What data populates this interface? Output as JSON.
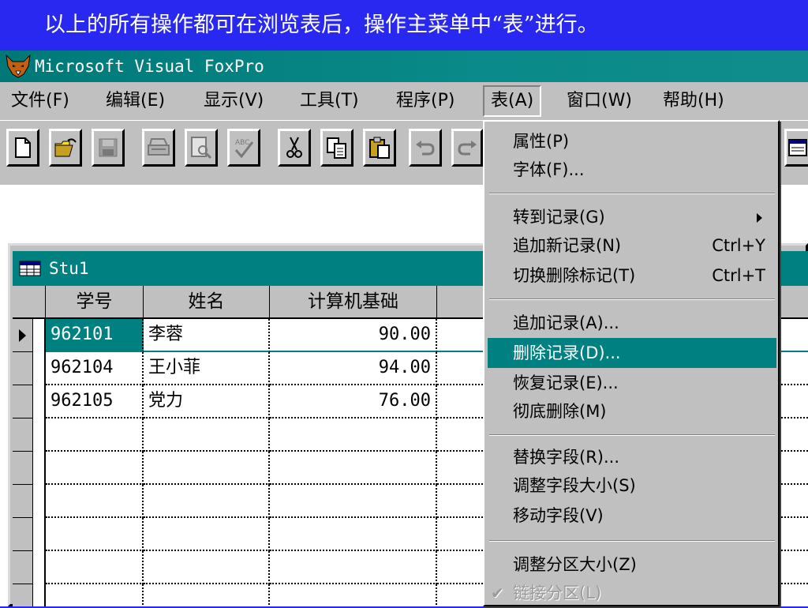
{
  "caption": "以上的所有操作都可在浏览表后，操作主菜单中“表”进行。",
  "window": {
    "title": "Microsoft Visual FoxPro"
  },
  "menubar": [
    {
      "label": "文件(F)"
    },
    {
      "label": "编辑(E)"
    },
    {
      "label": "显示(V)"
    },
    {
      "label": "工具(T)"
    },
    {
      "label": "程序(P)"
    },
    {
      "label": "表(A)",
      "active": true
    },
    {
      "label": "窗口(W)"
    },
    {
      "label": "帮助(H)"
    }
  ],
  "toolbar": {
    "buttons": [
      "new-icon",
      "open-icon",
      "save-icon",
      "print-icon",
      "print-preview-icon",
      "spell-check-icon",
      "cut-icon",
      "copy-icon",
      "paste-icon",
      "undo-icon",
      "redo-icon"
    ]
  },
  "browse": {
    "title": "Stu1",
    "columns": [
      "学号",
      "姓名",
      "计算机基础"
    ],
    "rows": [
      {
        "id": "962101",
        "name": "李蓉",
        "score": "90.00",
        "current": true
      },
      {
        "id": "962104",
        "name": "王小菲",
        "score": "94.00"
      },
      {
        "id": "962105",
        "name": "党力",
        "score": "76.00"
      }
    ]
  },
  "table_menu": {
    "groups": [
      [
        {
          "label": "属性(P)"
        },
        {
          "label": "字体(F)..."
        }
      ],
      [
        {
          "label": "转到记录(G)",
          "submenu": true
        },
        {
          "label": "追加新记录(N)",
          "shortcut": "Ctrl+Y"
        },
        {
          "label": "切换删除标记(T)",
          "shortcut": "Ctrl+T"
        }
      ],
      [
        {
          "label": "追加记录(A)..."
        },
        {
          "label": "删除记录(D)...",
          "highlighted": true
        },
        {
          "label": "恢复记录(E)..."
        },
        {
          "label": "彻底删除(M)"
        }
      ],
      [
        {
          "label": "替换字段(R)..."
        },
        {
          "label": "调整字段大小(S)"
        },
        {
          "label": "移动字段(V)"
        }
      ],
      [
        {
          "label": "调整分区大小(Z)"
        },
        {
          "label": "链接分区(L)",
          "checked": true,
          "disabled": true
        }
      ]
    ]
  },
  "colors": {
    "caption_bg": "#2828f0",
    "titlebar": "#008080",
    "highlight": "#008080",
    "face": "#c0c0c0"
  }
}
